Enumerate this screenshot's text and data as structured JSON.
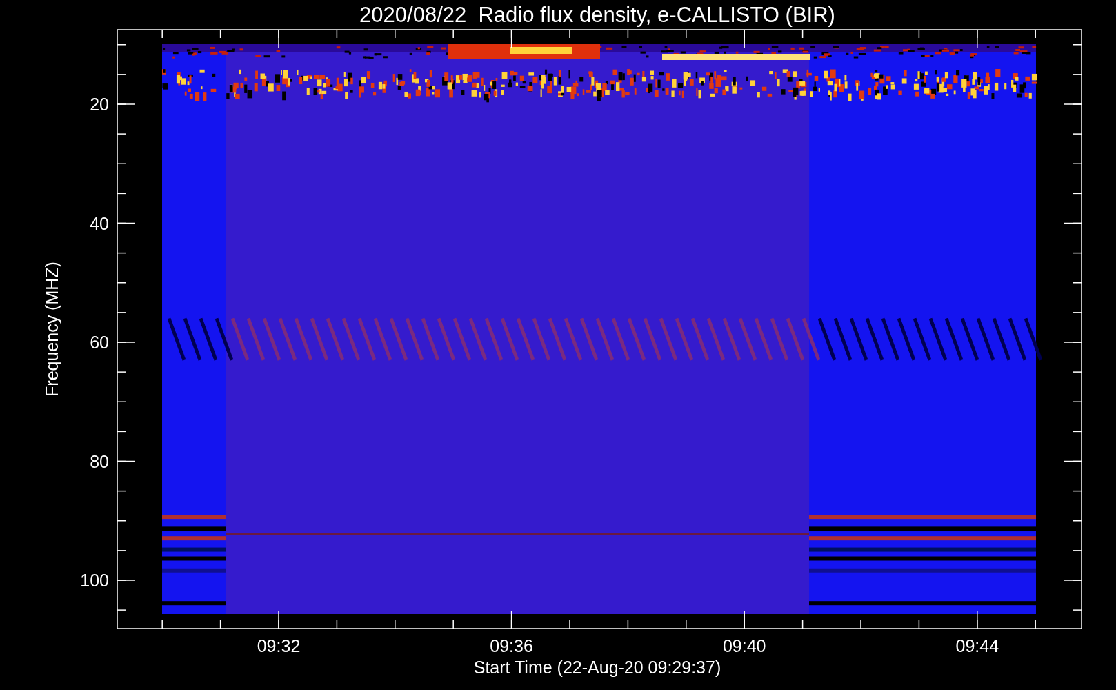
{
  "title": "2020/08/22  Radio flux density, e-CALLISTO (BIR)",
  "ylabel": "Frequency (MHZ)",
  "xlabel": "Start Time (22-Aug-20 09:29:37)",
  "yticks": [
    "20",
    "40",
    "60",
    "80",
    "100"
  ],
  "xticks": [
    "09:32",
    "09:36",
    "09:40",
    "09:44"
  ]
}
